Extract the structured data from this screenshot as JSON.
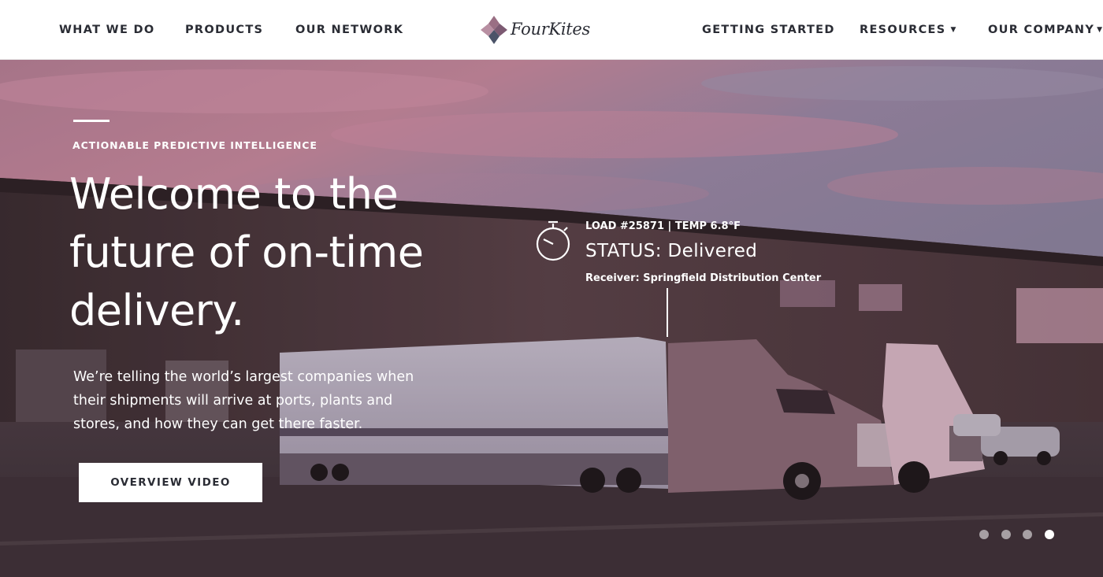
{
  "nav": {
    "left_items": [
      {
        "label": "WHAT WE DO"
      },
      {
        "label": "PRODUCTS"
      },
      {
        "label": "OUR NETWORK"
      }
    ],
    "logo_text": "FourKites",
    "right_items": [
      {
        "label": "GETTING STARTED"
      },
      {
        "label": "RESOURCES",
        "has_dropdown": true
      },
      {
        "label": "OUR COMPANY",
        "has_dropdown": true
      }
    ]
  },
  "hero": {
    "eyebrow": "ACTIONABLE PREDICTIVE INTELLIGENCE",
    "headline_lines": [
      "Welcome to the",
      "future of on-time",
      "delivery."
    ],
    "subtext_lines": [
      "We’re telling the world’s largest companies when",
      "their shipments will arrive at ports, plants and",
      "stores, and how they can get there faster."
    ],
    "cta_label": "OVERVIEW VIDEO",
    "status_overlay": {
      "icon": "stopwatch-icon",
      "load_line": "LOAD #25871 | TEMP 6.8°F",
      "status_line": "STATUS: Delivered",
      "receiver_line": "Receiver: Springfield Distribution Center"
    }
  },
  "carousel": {
    "slide_count": 4,
    "active_slide": 4
  },
  "colors": {
    "nav_text": "#2a2c34",
    "logo_diamond_mauve": "#9a6f84",
    "logo_diamond_slate": "#4b5368",
    "hero_text": "#ffffff",
    "sky_pink": "#c98aa0",
    "sky_slate": "#8f86a2"
  }
}
